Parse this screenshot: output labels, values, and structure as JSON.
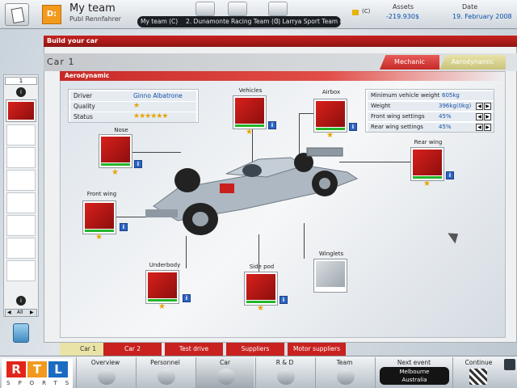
{
  "top": {
    "title": "My team",
    "subtitle": "Publ Rennfahrer",
    "logo_text": "D:",
    "teams": [
      "My team (C)",
      "2. Dunamonte Racing Team (C)",
      "3. Larrya Sport Team (C)"
    ],
    "currency_note": "(C)",
    "assets_label": "Assets",
    "assets_value": "-219.930$",
    "date_label": "Date",
    "date_value": "19. February 2008"
  },
  "window": {
    "title": "Build your car",
    "car_name": "Car 1",
    "tabs": [
      "Mechanic",
      "Aerodynamic"
    ],
    "section": "Aerodynamic"
  },
  "info": {
    "driver_label": "Driver",
    "driver_value": "Ginno Albatrone",
    "quality_label": "Quality",
    "quality_stars": 1,
    "status_label": "Status",
    "status_stars": 6
  },
  "stats": [
    {
      "label": "Minimum vehicle weight",
      "value": "605kg"
    },
    {
      "label": "Weight",
      "value": "396kg(0kg)"
    },
    {
      "label": "Front wing settings",
      "value": "45%"
    },
    {
      "label": "Rear wing settings",
      "value": "45%"
    }
  ],
  "parts": {
    "nose": "Nose",
    "front_wing": "Front wing",
    "underbody": "Underbody",
    "side_pod": "Side pod",
    "winglets": "Winglets",
    "rear_wing": "Rear wing",
    "airbox": "Airbox",
    "vehicles": "Vehicles"
  },
  "sidebar": {
    "top_label": "1",
    "nav_label": "All"
  },
  "bottom_tabs": [
    "Car 1",
    "Car 2",
    "Test drive",
    "Suppliers",
    "Motor suppliers"
  ],
  "nav": [
    "Overview",
    "Personnel",
    "Car",
    "R & D",
    "Team",
    "Next event",
    "Continue"
  ],
  "next_event": {
    "line1": "Melbourne",
    "line2": "Australia"
  },
  "brand": {
    "rtl": [
      "R",
      "T",
      "L"
    ],
    "sports": "SPORTS"
  }
}
